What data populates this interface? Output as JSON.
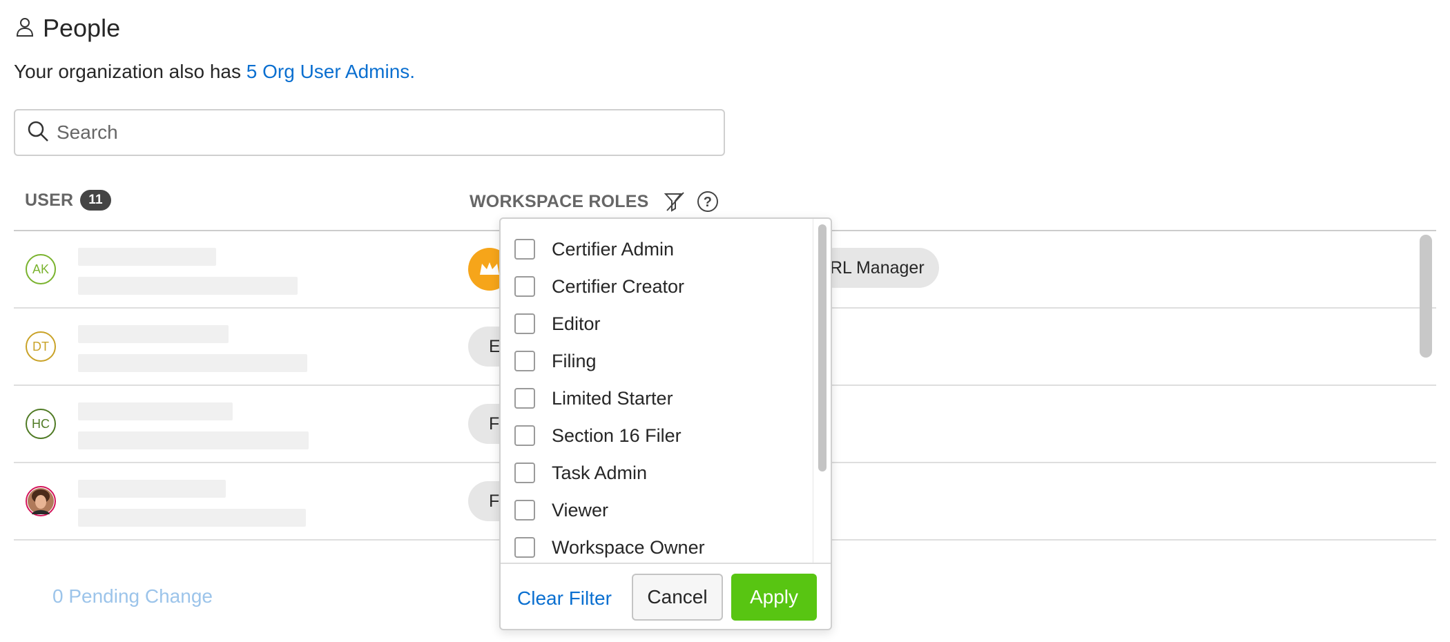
{
  "header": {
    "title": "People",
    "icon": "person-icon"
  },
  "org_notice": {
    "prefix": "Your organization also has ",
    "link": "5 Org User Admins."
  },
  "search": {
    "placeholder": "Search",
    "value": ""
  },
  "columns": {
    "user_label": "USER",
    "user_count": "11",
    "roles_label": "WORKSPACE ROLES"
  },
  "rows": [
    {
      "initials": "AK",
      "avatar_color": "#7ab32e",
      "role_label": "RL Manager",
      "role_fragment": ""
    },
    {
      "initials": "DT",
      "avatar_color": "#c9a227",
      "role_label": "",
      "role_fragment": "E"
    },
    {
      "initials": "HC",
      "avatar_color": "#4f7a24",
      "role_label": "",
      "role_fragment": "F"
    },
    {
      "initials": "",
      "avatar_color": "#d4145a",
      "role_label": "",
      "role_fragment": "F"
    }
  ],
  "role_filter": {
    "options": [
      "Certifier Admin",
      "Certifier Creator",
      "Editor",
      "Filing",
      "Limited Starter",
      "Section 16 Filer",
      "Task Admin",
      "Viewer",
      "Workspace Owner"
    ],
    "clear_label": "Clear Filter",
    "cancel_label": "Cancel",
    "apply_label": "Apply"
  },
  "footer": {
    "pending": "0 Pending Change"
  },
  "colors": {
    "link": "#0a6fd0",
    "apply": "#58c512",
    "crown": "#f6a51a",
    "pending": "#9cc4ea"
  }
}
